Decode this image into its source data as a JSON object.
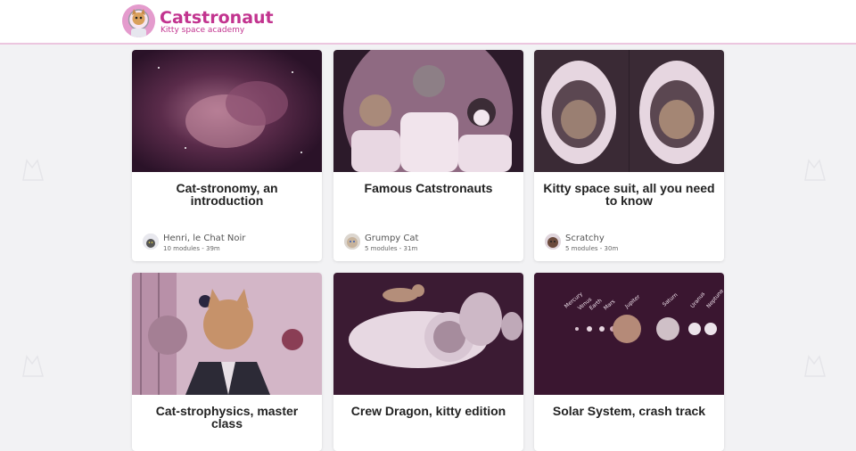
{
  "header": {
    "title": "Catstronaut",
    "subtitle": "Kitty space academy",
    "logo_icon": "cat-astronaut-logo"
  },
  "colors": {
    "brand": "#c2348f",
    "tint": "#7a3563",
    "background": "#f2f2f4"
  },
  "courses": [
    {
      "title": "Cat-stronomy, an introduction",
      "image_icon": "nebula-cat-image",
      "author": {
        "name": "Henri, le Chat Noir",
        "meta": "10 modules - 39m",
        "avatar_icon": "henri-avatar"
      }
    },
    {
      "title": "Famous Catstronauts",
      "image_icon": "astronaut-cats-moon-image",
      "author": {
        "name": "Grumpy Cat",
        "meta": "5 modules - 31m",
        "avatar_icon": "grumpy-cat-avatar"
      }
    },
    {
      "title": "Kitty space suit, all you need to know",
      "image_icon": "cats-in-helmets-image",
      "author": {
        "name": "Scratchy",
        "meta": "5 modules - 30m",
        "avatar_icon": "scratchy-avatar"
      }
    },
    {
      "title": "Cat-strophysics, master class",
      "image_icon": "cat-in-suit-planets-image"
    },
    {
      "title": "Crew Dragon, kitty edition",
      "image_icon": "cat-on-spacecraft-image"
    },
    {
      "title": "Solar System, crash track",
      "image_icon": "cat-planets-image",
      "planet_labels": [
        "Mercury",
        "Venus",
        "Earth",
        "Mars",
        "Jupiter",
        "Saturn",
        "Uranus",
        "Neptune"
      ]
    }
  ]
}
